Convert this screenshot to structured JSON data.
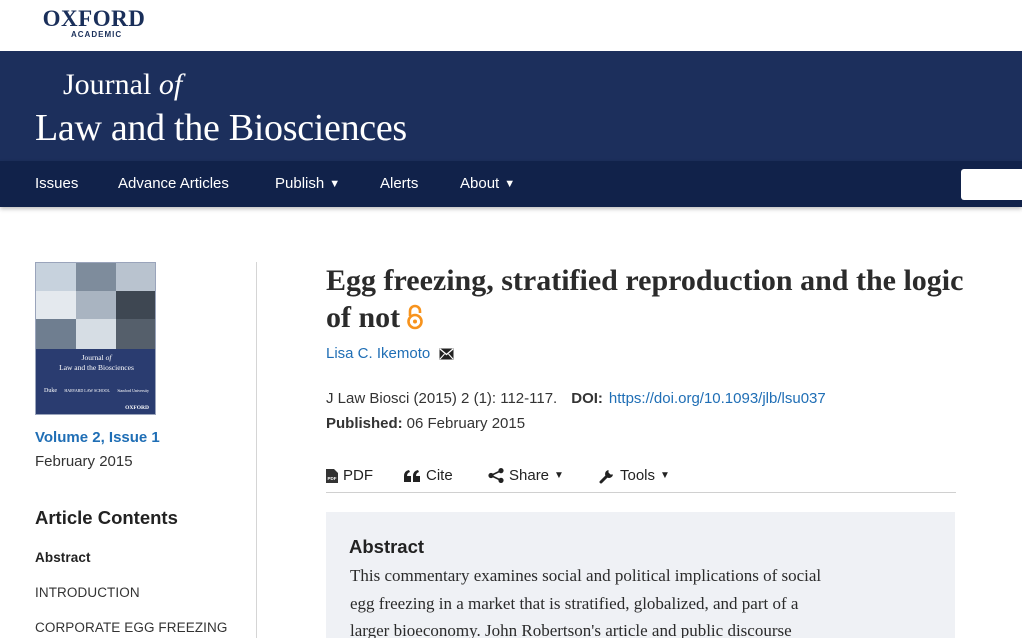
{
  "brand": {
    "publisher_big": "OXFORD",
    "publisher_small": "ACADEMIC"
  },
  "journal": {
    "title_line1_a": "Journal ",
    "title_line1_b": "of",
    "title_line2": "Law and the Biosciences"
  },
  "nav": {
    "items": [
      {
        "label": "Issues",
        "caret": false
      },
      {
        "label": "Advance Articles",
        "caret": false
      },
      {
        "label": "Publish",
        "caret": true
      },
      {
        "label": "Alerts",
        "caret": false
      },
      {
        "label": "About",
        "caret": true
      }
    ],
    "caret_glyph": "▼"
  },
  "cover": {
    "title_a": "Journal ",
    "title_b": "of",
    "title_c": "Law and the Biosciences",
    "logo_1": "Duke",
    "logo_2": "HARVARD LAW SCHOOL",
    "logo_3": "Stanford University",
    "logo_ox": "OXFORD"
  },
  "issue": {
    "volume": "Volume 2, Issue 1",
    "date": "February 2015"
  },
  "contents": {
    "heading": "Article Contents",
    "items": [
      {
        "label": "Abstract",
        "active": true
      },
      {
        "label": "INTRODUCTION",
        "active": false
      },
      {
        "label": "CORPORATE EGG FREEZING",
        "active": false
      }
    ]
  },
  "article": {
    "title": "Egg freezing, stratified reproduction and the logic of not",
    "author": "Lisa C. Ikemoto",
    "citation": "J Law Biosci (2015) 2 (1): 112-117.",
    "doi_label": "DOI:",
    "doi": "https://doi.org/10.1093/jlb/lsu037",
    "published_label": "Published:",
    "published_date": "06 February 2015"
  },
  "tools": {
    "pdf": "PDF",
    "cite": "Cite",
    "share": "Share",
    "tools": "Tools",
    "caret_glyph": "▼"
  },
  "abstract": {
    "heading": "Abstract",
    "lines": [
      "This commentary examines social and political implications of social",
      "egg freezing in a market that is stratified, globalized, and part of a",
      "larger bioeconomy. John Robertson's article and public discourse"
    ]
  },
  "colors": {
    "navy_banner": "#1c2f5c",
    "navy_nav": "#11224a",
    "link_blue": "#1f6eb5",
    "open_access_orange": "#f7931d",
    "abstract_bg": "#eff1f5"
  }
}
